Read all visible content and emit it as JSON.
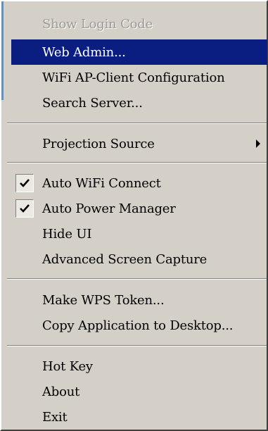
{
  "menu": {
    "items": [
      {
        "label": "Show Login Code"
      },
      {
        "label": "Web Admin..."
      },
      {
        "label": "WiFi AP-Client Configuration"
      },
      {
        "label": "Search Server..."
      },
      {
        "label": "Projection Source"
      },
      {
        "label": "Auto WiFi Connect"
      },
      {
        "label": "Auto Power Manager"
      },
      {
        "label": "Hide UI"
      },
      {
        "label": "Advanced Screen Capture"
      },
      {
        "label": "Make WPS Token..."
      },
      {
        "label": "Copy Application to Desktop..."
      },
      {
        "label": "Hot Key"
      },
      {
        "label": "About"
      },
      {
        "label": "Exit"
      }
    ],
    "state": {
      "disabled_item": "Show Login Code",
      "highlighted_item": "Web Admin...",
      "checked_items": [
        "Auto WiFi Connect",
        "Auto Power Manager"
      ],
      "submenu_items": [
        "Projection Source"
      ]
    },
    "colors": {
      "menu_background": "#d4d0c8",
      "highlight": "#0a1e82",
      "disabled_text": "#9c9a95"
    },
    "icons": {
      "check": "checkmark-icon",
      "submenu": "submenu-arrow-icon"
    }
  }
}
